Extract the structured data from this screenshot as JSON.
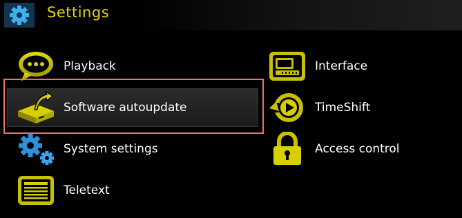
{
  "header": {
    "title": "Settings",
    "icon": "gear-icon"
  },
  "colors": {
    "accent": "#e6d800",
    "icon_yellow": "#c9c100",
    "selection_border": "#e8736c",
    "text": "#ffffff",
    "background": "#000000"
  },
  "menu": {
    "selected": "Software autoupdate",
    "left": [
      {
        "label": "Playback",
        "icon": "speech-bubble-icon"
      },
      {
        "label": "Software autoupdate",
        "icon": "software-update-icon"
      },
      {
        "label": "System settings",
        "icon": "gears-icon"
      },
      {
        "label": "Teletext",
        "icon": "teletext-icon"
      }
    ],
    "right": [
      {
        "label": "Interface",
        "icon": "interface-screen-icon"
      },
      {
        "label": "TimeShift",
        "icon": "timeshift-icon"
      },
      {
        "label": "Access control",
        "icon": "padlock-icon"
      }
    ]
  }
}
